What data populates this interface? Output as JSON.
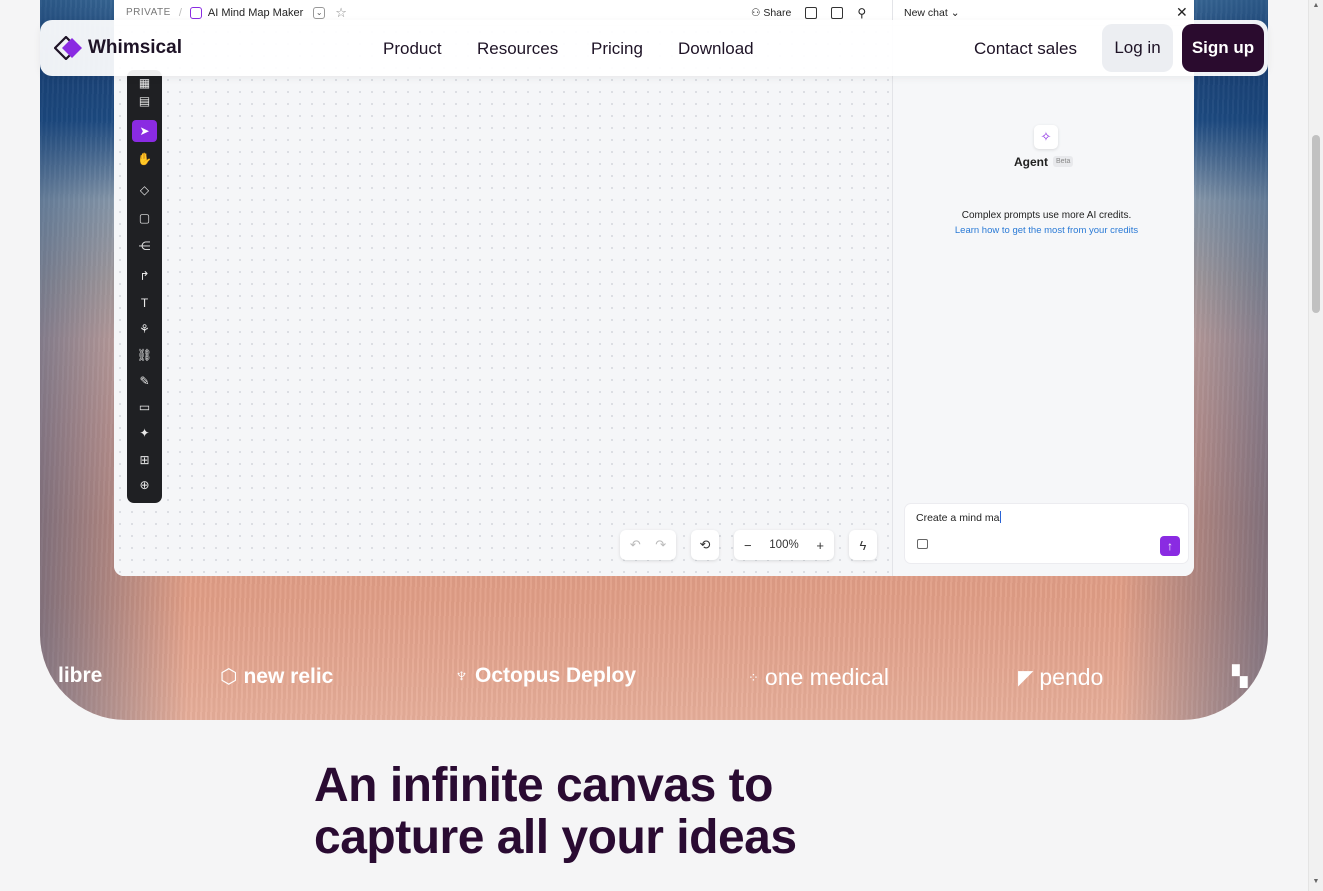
{
  "nav": {
    "brand": "Whimsical",
    "links": [
      "Product",
      "Resources",
      "Pricing",
      "Download"
    ],
    "contact": "Contact sales",
    "login": "Log in",
    "signup": "Sign up"
  },
  "app": {
    "privacy": "PRIVATE",
    "doc_title": "AI Mind Map Maker",
    "share": "Share",
    "new_chat": "New chat",
    "zoom": "100%",
    "agent": {
      "name": "Agent",
      "badge": "Beta",
      "note": "Complex prompts use more AI credits.",
      "link": "Learn how to get the most from your credits",
      "input_value": "Create a mind ma"
    }
  },
  "brands": [
    "libre",
    "new relic",
    "Octopus Deploy",
    "one medical",
    "pendo"
  ],
  "headline": {
    "line1": "An infinite canvas to",
    "line2": "capture all your ideas"
  },
  "colors": {
    "accent": "#8a2be2",
    "dark": "#2a0b2e"
  }
}
